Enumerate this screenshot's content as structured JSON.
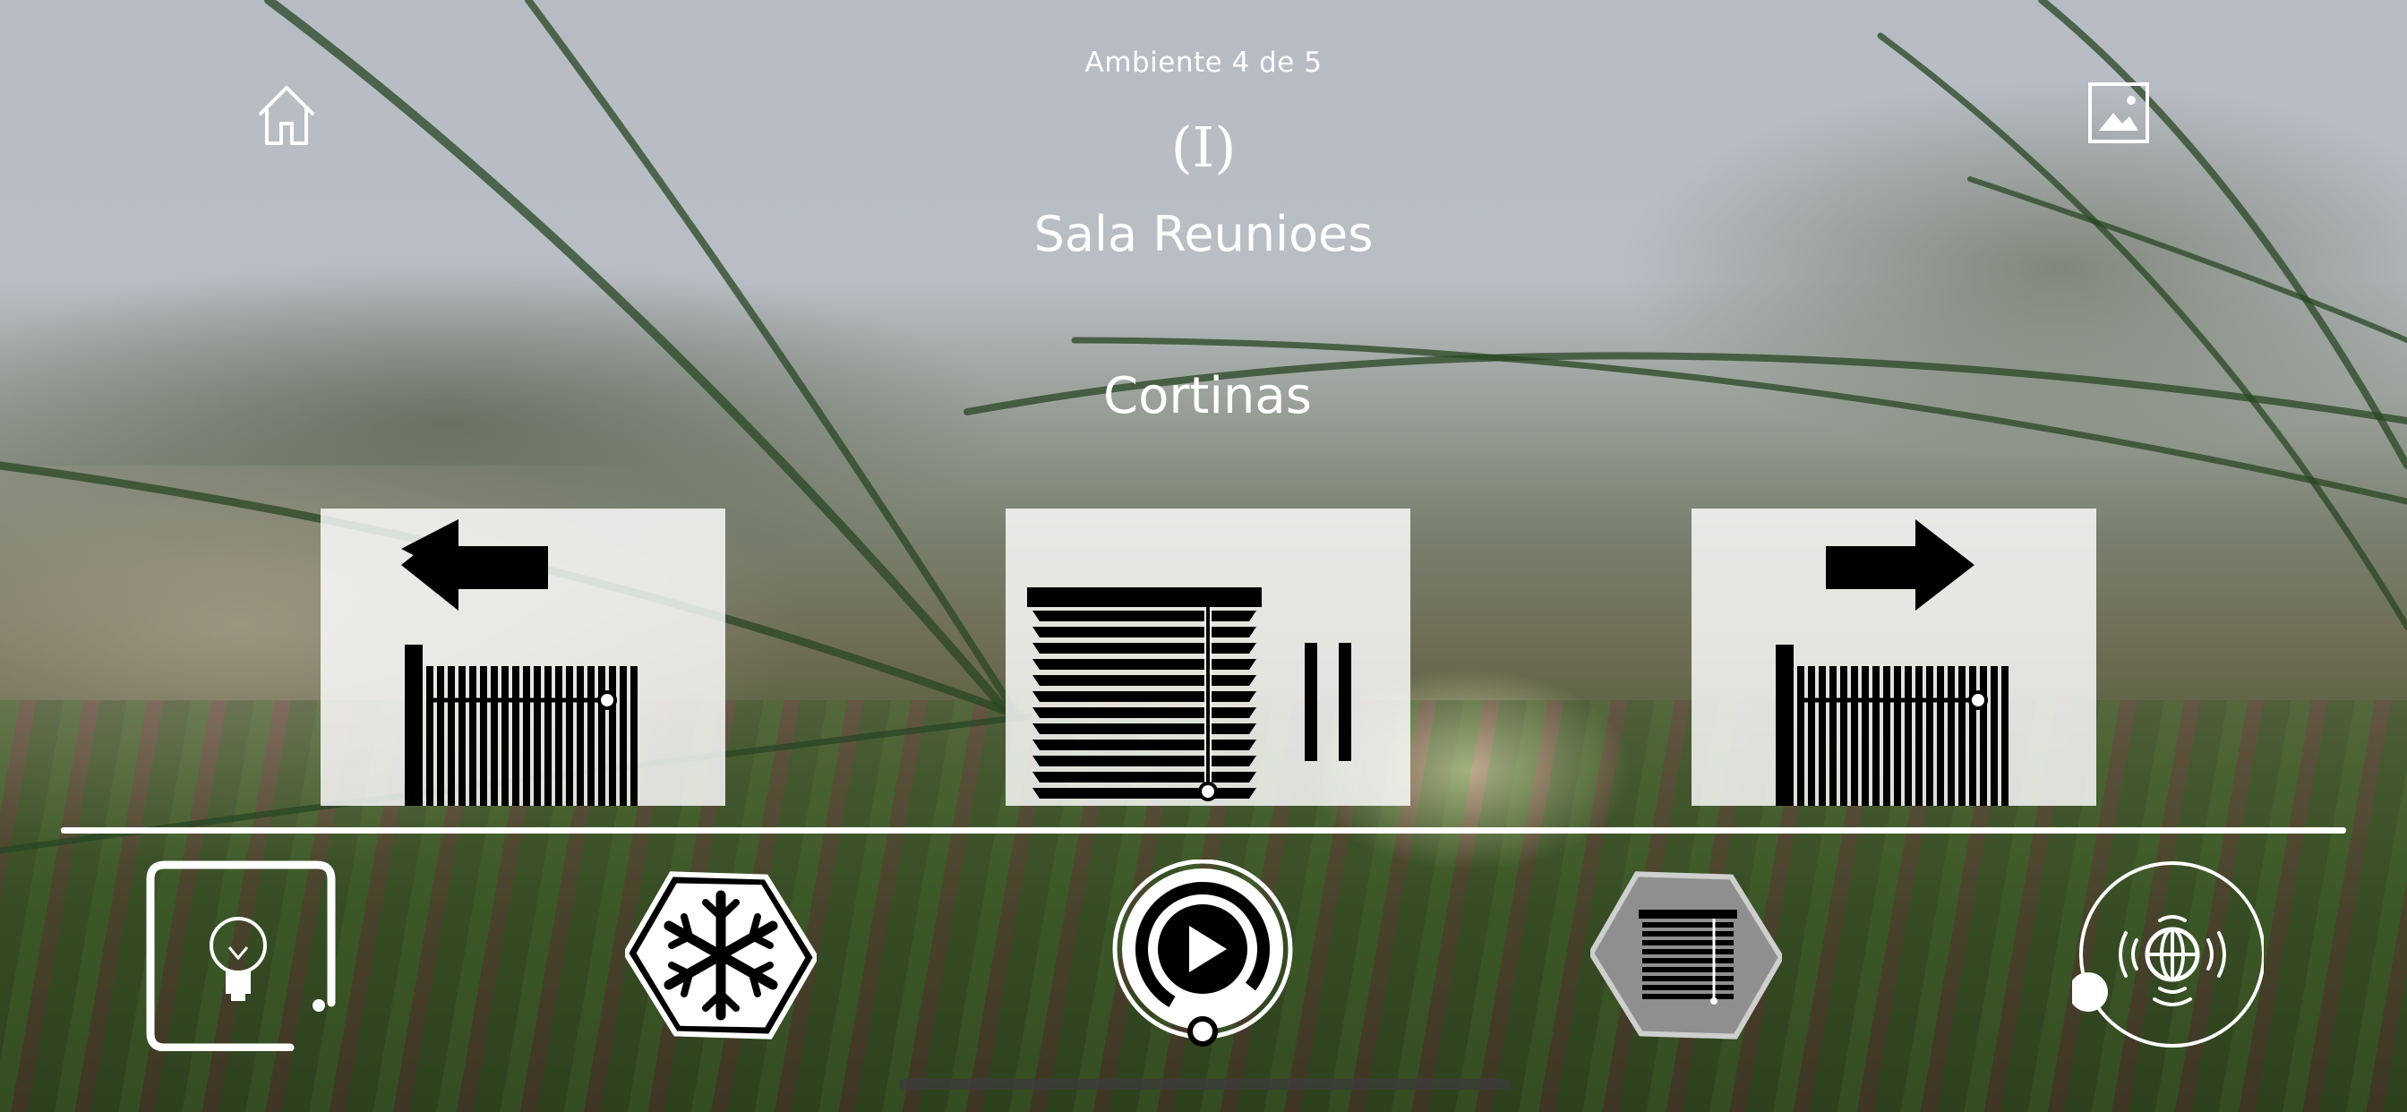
{
  "header": {
    "ambient_label": "Ambiente 4 de 5",
    "mode_label": "(I)",
    "room_name": "Sala Reunioes"
  },
  "section": {
    "title": "Cortinas"
  },
  "curtain_controls": [
    {
      "name": "open-left",
      "icon": "gate-arrow-left-icon"
    },
    {
      "name": "pause",
      "icon": "blinds-pause-icon"
    },
    {
      "name": "open-right",
      "icon": "gate-arrow-right-icon"
    }
  ],
  "bottom_nav": [
    {
      "name": "lights",
      "icon": "lightbulb-icon"
    },
    {
      "name": "climate",
      "icon": "snowflake-icon"
    },
    {
      "name": "media",
      "icon": "play-icon"
    },
    {
      "name": "curtains",
      "icon": "blinds-icon",
      "active": true
    },
    {
      "name": "network",
      "icon": "globe-signal-icon"
    }
  ],
  "colors": {
    "tile_bg": "#f2f2f2",
    "icon": "#000000",
    "nav_outline": "#ffffff",
    "active_nav_fill": "#8f8f8f"
  }
}
